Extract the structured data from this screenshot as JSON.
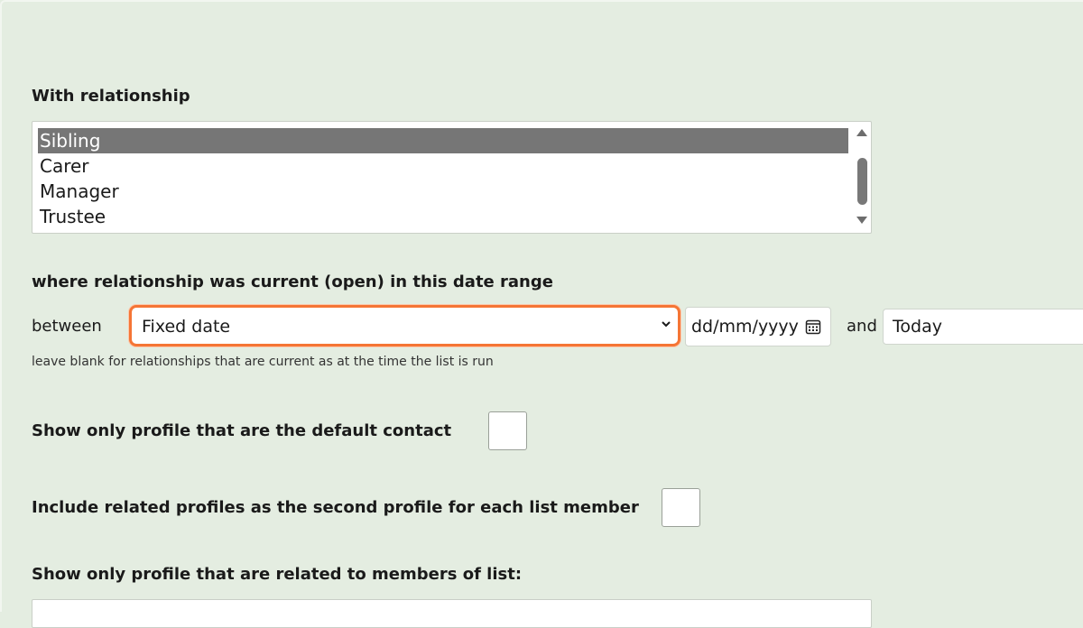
{
  "relationship": {
    "heading": "With relationship",
    "options": [
      {
        "label": "Sibling",
        "selected": true
      },
      {
        "label": "Carer",
        "selected": false
      },
      {
        "label": "Manager",
        "selected": false
      },
      {
        "label": "Trustee",
        "selected": false
      }
    ]
  },
  "date_range": {
    "heading": "where relationship was current (open) in this date range",
    "between_label": "between",
    "range_type_value": "Fixed date",
    "start_date_placeholder": "dd/mm/yyyy",
    "and_label": "and",
    "end_value": "Today",
    "hint": "leave blank for relationships that are current as at the time the list is run"
  },
  "default_contact": {
    "label": "Show only profile that are the default contact",
    "checked": false
  },
  "include_related": {
    "label": "Include related profiles as the second profile for each list member",
    "checked": false
  },
  "members_of_list": {
    "heading": "Show only profile that are related to members of list:"
  },
  "colors": {
    "background": "#e4ede1",
    "focus_ring": "#f57535",
    "selected_option": "#767676"
  }
}
